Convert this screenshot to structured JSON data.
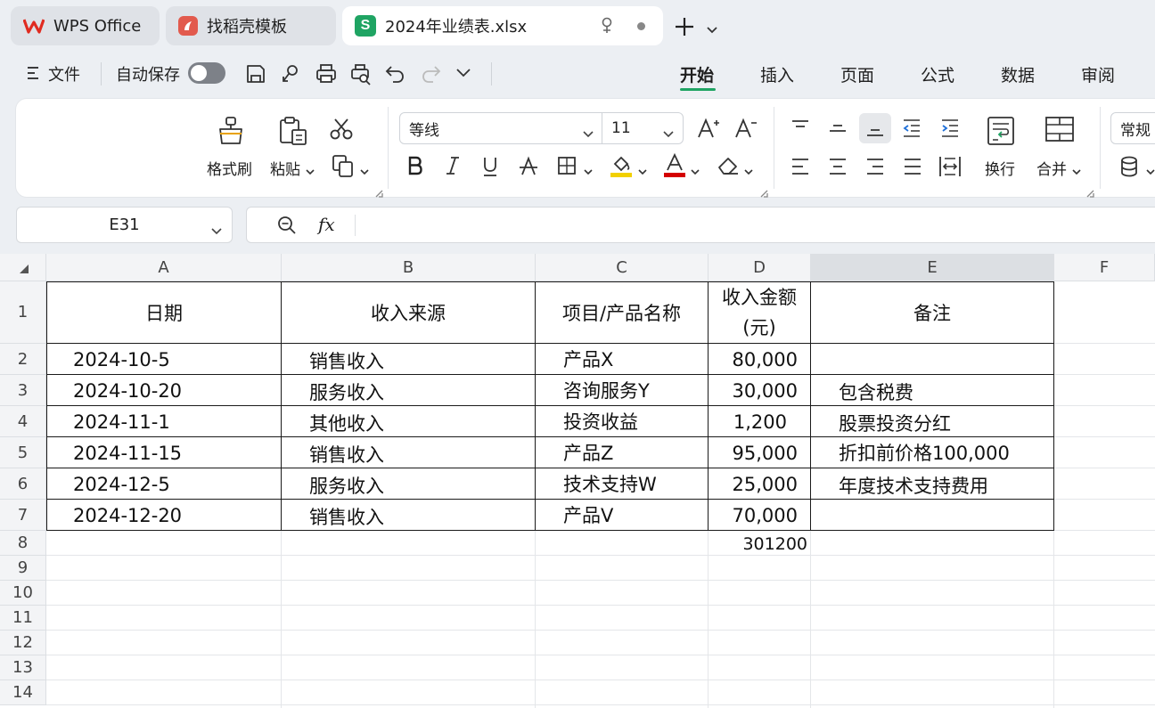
{
  "tabs": [
    {
      "label": "WPS Office"
    },
    {
      "label": "找稻壳模板"
    },
    {
      "label": "2024年业绩表.xlsx"
    }
  ],
  "menu": {
    "file_label": "文件",
    "autosave_label": "自动保存"
  },
  "ribbon_tabs": [
    "开始",
    "插入",
    "页面",
    "公式",
    "数据",
    "审阅"
  ],
  "ribbon": {
    "format_painter_label": "格式刷",
    "paste_label": "粘贴",
    "font_name": "等线",
    "font_size": "11",
    "wrap_label": "换行",
    "merge_label": "合并",
    "number_format": "常规"
  },
  "formula_bar": {
    "name_box": "E31",
    "fx_label": "fx",
    "formula": ""
  },
  "columns": [
    "A",
    "B",
    "C",
    "D",
    "E",
    "F"
  ],
  "rows": [
    "1",
    "2",
    "3",
    "4",
    "5",
    "6",
    "7",
    "8",
    "9",
    "10",
    "11",
    "12",
    "13",
    "14"
  ],
  "table": {
    "header": {
      "date": "日期",
      "source": "收入来源",
      "product": "项目/产品名称",
      "amount_line1": "收入金额",
      "amount_line2": "(元)",
      "note": "备注"
    },
    "rows": [
      {
        "date": "2024-10-5",
        "source": "销售收入",
        "product": "产品X",
        "amount": "80,000",
        "note": ""
      },
      {
        "date": "2024-10-20",
        "source": "服务收入",
        "product": "咨询服务Y",
        "amount": "30,000",
        "note": "包含税费"
      },
      {
        "date": "2024-11-1",
        "source": "其他收入",
        "product": "投资收益",
        "amount": "1,200",
        "note": "股票投资分红"
      },
      {
        "date": "2024-11-15",
        "source": "销售收入",
        "product": "产品Z",
        "amount": "95,000",
        "note": "折扣前价格100,000"
      },
      {
        "date": "2024-12-5",
        "source": "服务收入",
        "product": "技术支持W",
        "amount": "25,000",
        "note": "年度技术支持费用"
      },
      {
        "date": "2024-12-20",
        "source": "销售收入",
        "product": "产品V",
        "amount": "70,000",
        "note": ""
      }
    ],
    "total": "301200"
  },
  "colors": {
    "accent": "#1fa463",
    "highlight": "#f2d000",
    "font_color": "#d40000"
  }
}
